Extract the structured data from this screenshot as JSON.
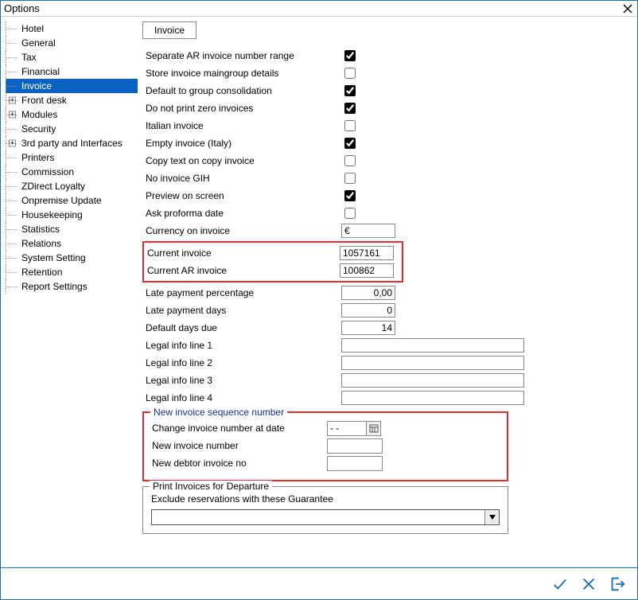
{
  "window": {
    "title": "Options"
  },
  "tree": {
    "items": [
      {
        "label": "Hotel",
        "expander": ""
      },
      {
        "label": "General",
        "expander": ""
      },
      {
        "label": "Tax",
        "expander": ""
      },
      {
        "label": "Financial",
        "expander": ""
      },
      {
        "label": "Invoice",
        "expander": "",
        "selected": true
      },
      {
        "label": "Front desk",
        "expander": "+"
      },
      {
        "label": "Modules",
        "expander": "+"
      },
      {
        "label": "Security",
        "expander": ""
      },
      {
        "label": "3rd party and Interfaces",
        "expander": "+"
      },
      {
        "label": "Printers",
        "expander": ""
      },
      {
        "label": "Commission",
        "expander": ""
      },
      {
        "label": "ZDirect Loyalty",
        "expander": ""
      },
      {
        "label": "Onpremise Update",
        "expander": ""
      },
      {
        "label": "Housekeeping",
        "expander": ""
      },
      {
        "label": "Statistics",
        "expander": ""
      },
      {
        "label": "Relations",
        "expander": ""
      },
      {
        "label": "System Setting",
        "expander": ""
      },
      {
        "label": "Retention",
        "expander": ""
      },
      {
        "label": "Report Settings",
        "expander": ""
      }
    ]
  },
  "tabs": {
    "active": "Invoice"
  },
  "form": {
    "separate_ar_label": "Separate AR invoice number range",
    "separate_ar_checked": true,
    "store_maingroup_label": "Store invoice maingroup details",
    "store_maingroup_checked": false,
    "default_group_label": "Default to group consolidation",
    "default_group_checked": true,
    "no_zero_label": "Do not print zero invoices",
    "no_zero_checked": true,
    "italian_label": "Italian invoice",
    "italian_checked": false,
    "empty_italy_label": "Empty invoice (Italy)",
    "empty_italy_checked": true,
    "copy_text_label": "Copy text on copy invoice",
    "copy_text_checked": false,
    "no_gih_label": "No invoice GIH",
    "no_gih_checked": false,
    "preview_label": "Preview on screen",
    "preview_checked": true,
    "ask_proforma_label": "Ask proforma date",
    "ask_proforma_checked": false,
    "currency_label": "Currency on invoice",
    "currency_value": "€",
    "current_invoice_label": "Current invoice",
    "current_invoice_value": "1057161",
    "current_ar_label": "Current AR invoice",
    "current_ar_value": "100862",
    "late_pct_label": "Late payment percentage",
    "late_pct_value": "0,00",
    "late_days_label": "Late payment days",
    "late_days_value": "0",
    "default_due_label": "Default days due",
    "default_due_value": "14",
    "legal1_label": "Legal info line 1",
    "legal1_value": "",
    "legal2_label": "Legal info line 2",
    "legal2_value": "",
    "legal3_label": "Legal info line 3",
    "legal3_value": "",
    "legal4_label": "Legal info line 4",
    "legal4_value": ""
  },
  "seq": {
    "legend": "New invoice sequence number",
    "change_at_label": "Change invoice number at date",
    "change_at_value": "-  -",
    "new_invoice_label": "New invoice number",
    "new_invoice_value": "",
    "new_debtor_label": "New debtor invoice no",
    "new_debtor_value": ""
  },
  "departure": {
    "legend": "Print Invoices for Departure",
    "exclude_label": "Exclude reservations with these Guarantee",
    "combo_value": ""
  }
}
